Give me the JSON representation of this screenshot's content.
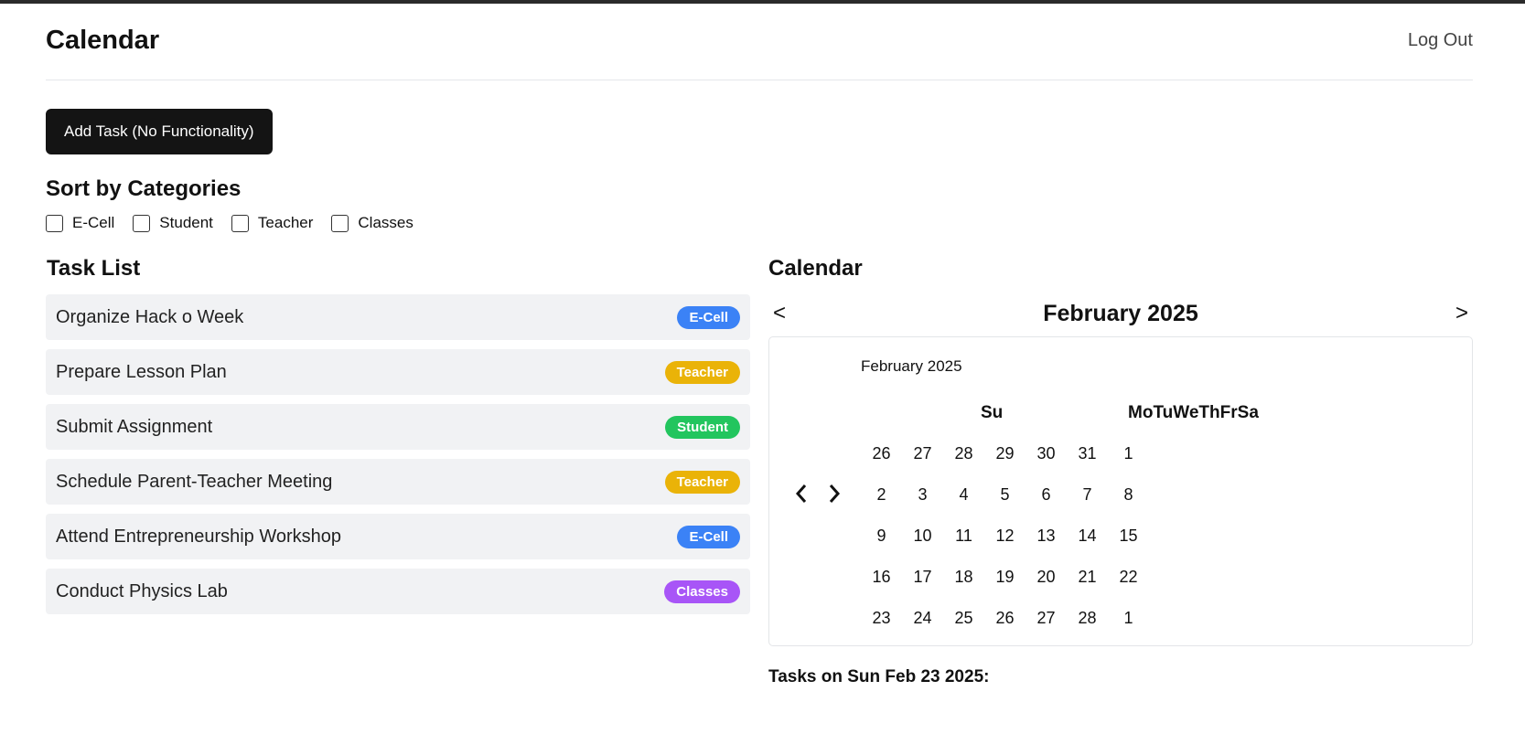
{
  "header": {
    "title": "Calendar",
    "logout_label": "Log Out"
  },
  "add_task_label": "Add Task (No Functionality)",
  "sort": {
    "title": "Sort by Categories",
    "categories": [
      "E-Cell",
      "Student",
      "Teacher",
      "Classes"
    ]
  },
  "task_list": {
    "title": "Task List",
    "tasks": [
      {
        "name": "Organize Hack o Week",
        "category": "E-Cell",
        "color": "#3b82f6"
      },
      {
        "name": "Prepare Lesson Plan",
        "category": "Teacher",
        "color": "#eab308"
      },
      {
        "name": "Submit Assignment",
        "category": "Student",
        "color": "#22c55e"
      },
      {
        "name": "Schedule Parent-Teacher Meeting",
        "category": "Teacher",
        "color": "#eab308"
      },
      {
        "name": "Attend Entrepreneurship Workshop",
        "category": "E-Cell",
        "color": "#3b82f6"
      },
      {
        "name": "Conduct Physics Lab",
        "category": "Classes",
        "color": "#a855f7"
      }
    ]
  },
  "calendar": {
    "title": "Calendar",
    "month_title": "February 2025",
    "prev_label": "<",
    "next_label": ">",
    "inner_label": "February 2025",
    "weekday_first": "Su",
    "weekdays_rest": [
      "Mo",
      "Tu",
      "We",
      "Th",
      "Fr",
      "Sa"
    ],
    "weeks": [
      [
        "26",
        "27",
        "28",
        "29",
        "30",
        "31",
        "1"
      ],
      [
        "2",
        "3",
        "4",
        "5",
        "6",
        "7",
        "8"
      ],
      [
        "9",
        "10",
        "11",
        "12",
        "13",
        "14",
        "15"
      ],
      [
        "16",
        "17",
        "18",
        "19",
        "20",
        "21",
        "22"
      ],
      [
        "23",
        "24",
        "25",
        "26",
        "27",
        "28",
        "1"
      ]
    ]
  },
  "tasks_on_label": "Tasks on Sun Feb 23 2025:"
}
